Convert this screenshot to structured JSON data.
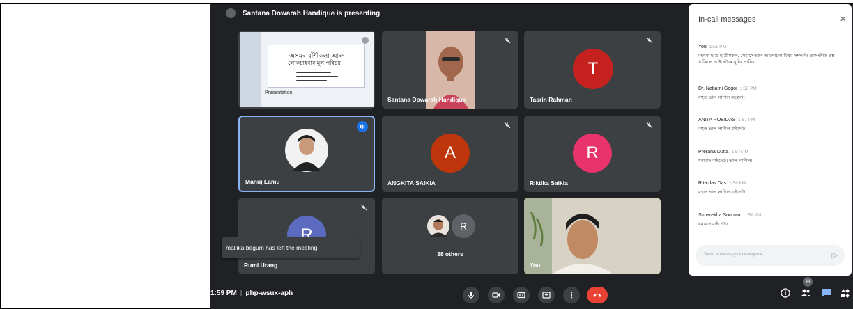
{
  "presenting_banner": "Santana Dowarah Handique is presenting",
  "tiles": {
    "presentation": {
      "slide_title_1": "অসমৰ বাঁশীকলা আৰু",
      "slide_title_2": "লোকচাইবাৰ মূল পৰিচয়",
      "presenter_caption": "Presentation"
    },
    "santana": {
      "name": "Santana Dowarah Handique"
    },
    "tasrin": {
      "name": "Tasrin Rahman",
      "initial": "T",
      "color": "#c5221f"
    },
    "manuj": {
      "name": "Manuj Lamu"
    },
    "angkita": {
      "name": "ANGKITA SAIKIA",
      "initial": "A",
      "color": "#bf360c"
    },
    "riktika": {
      "name": "Riktika Saikia",
      "initial": "R",
      "color": "#e8336d"
    },
    "rumi": {
      "name": "Rumi Urang",
      "initial": "R",
      "color": "#5c6bc0"
    },
    "others": {
      "label": "38 others",
      "initial": "R",
      "color": "#5f6368"
    },
    "you": {
      "name": "You"
    }
  },
  "toast": "mallika begum has left the meeting",
  "bottom_bar": {
    "time": "1:59 PM",
    "meeting_code": "php-wsux-aph",
    "participants_count": "44"
  },
  "chat": {
    "title": "In-call messages",
    "close": "×",
    "messages": [
      {
        "sender": "You",
        "time": "1:51 PM",
        "text": "মহৎমা ছাত্ৰ-ছাত্ৰীসকল, সেমাসেতকৰ আলোচনা বিষয় সম্পৰ্কত প্ৰাসংগিক প্ৰশ্ন থাকিলে আইদেউক সুধিব পাৰিব৷"
      },
      {
        "sender": "Dr. Nabami Gogoi",
        "time": "1:56 PM",
        "text": "বহুত ভাল লাগিল মহন্তৰা।"
      },
      {
        "sender": "ANITA ROBIDAS",
        "time": "1:57 PM",
        "text": "বহুত ভাল লাগিল বাইদেউ"
      },
      {
        "sender": "Prerana Dutta",
        "time": "1:57 PM",
        "text": "ধন্যবাদ বাইদেউ। ভাল লাগিল।"
      },
      {
        "sender": "Rita das Das",
        "time": "1:58 PM",
        "text": "বহুত ভাল লাগিল বাইদেউ"
      },
      {
        "sender": "Simarekha Sonowal",
        "time": "1:59 PM",
        "text": "ধন্যবাদ বাইদেউ।"
      }
    ],
    "input_placeholder": "Send a message to everyone"
  }
}
